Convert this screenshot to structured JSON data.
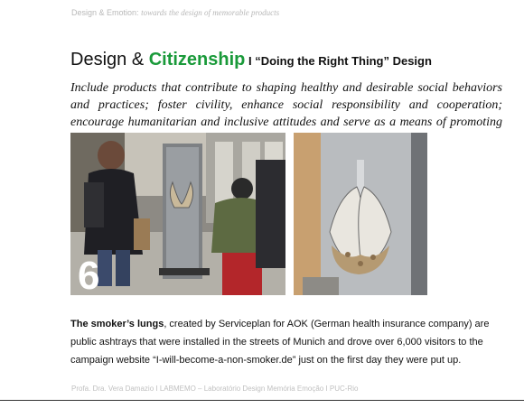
{
  "header": {
    "prefix": "Design & Emotion:",
    "subtitle": "towards the design of memorable products"
  },
  "title": {
    "part1": "Design & ",
    "highlight": "Citizenship",
    "part2": " I “Doing the Right Thing” Design"
  },
  "intro": "Include products that contribute to shaping healthy and desirable social behaviors and practices; foster civility, enhance social responsibility and cooperation; encourage humanitarian and inclusive attitudes and serve as a means of promoting the common good.",
  "slide_number": "6",
  "body": {
    "bold": "The smoker’s lungs",
    "rest": ", created by Serviceplan for AOK (German health insurance company) are public ashtrays that were installed in the streets of Munich and drove over 6,000 visitors to the campaign website “I-will-become-a-non-smoker.de” just on the first day they were put up."
  },
  "footer": "Profa. Dra. Vera Damazio I LABMEMO – Laboratório Design Memória Emoção I PUC-Rio",
  "colors": {
    "accent": "#1a9a3a"
  }
}
